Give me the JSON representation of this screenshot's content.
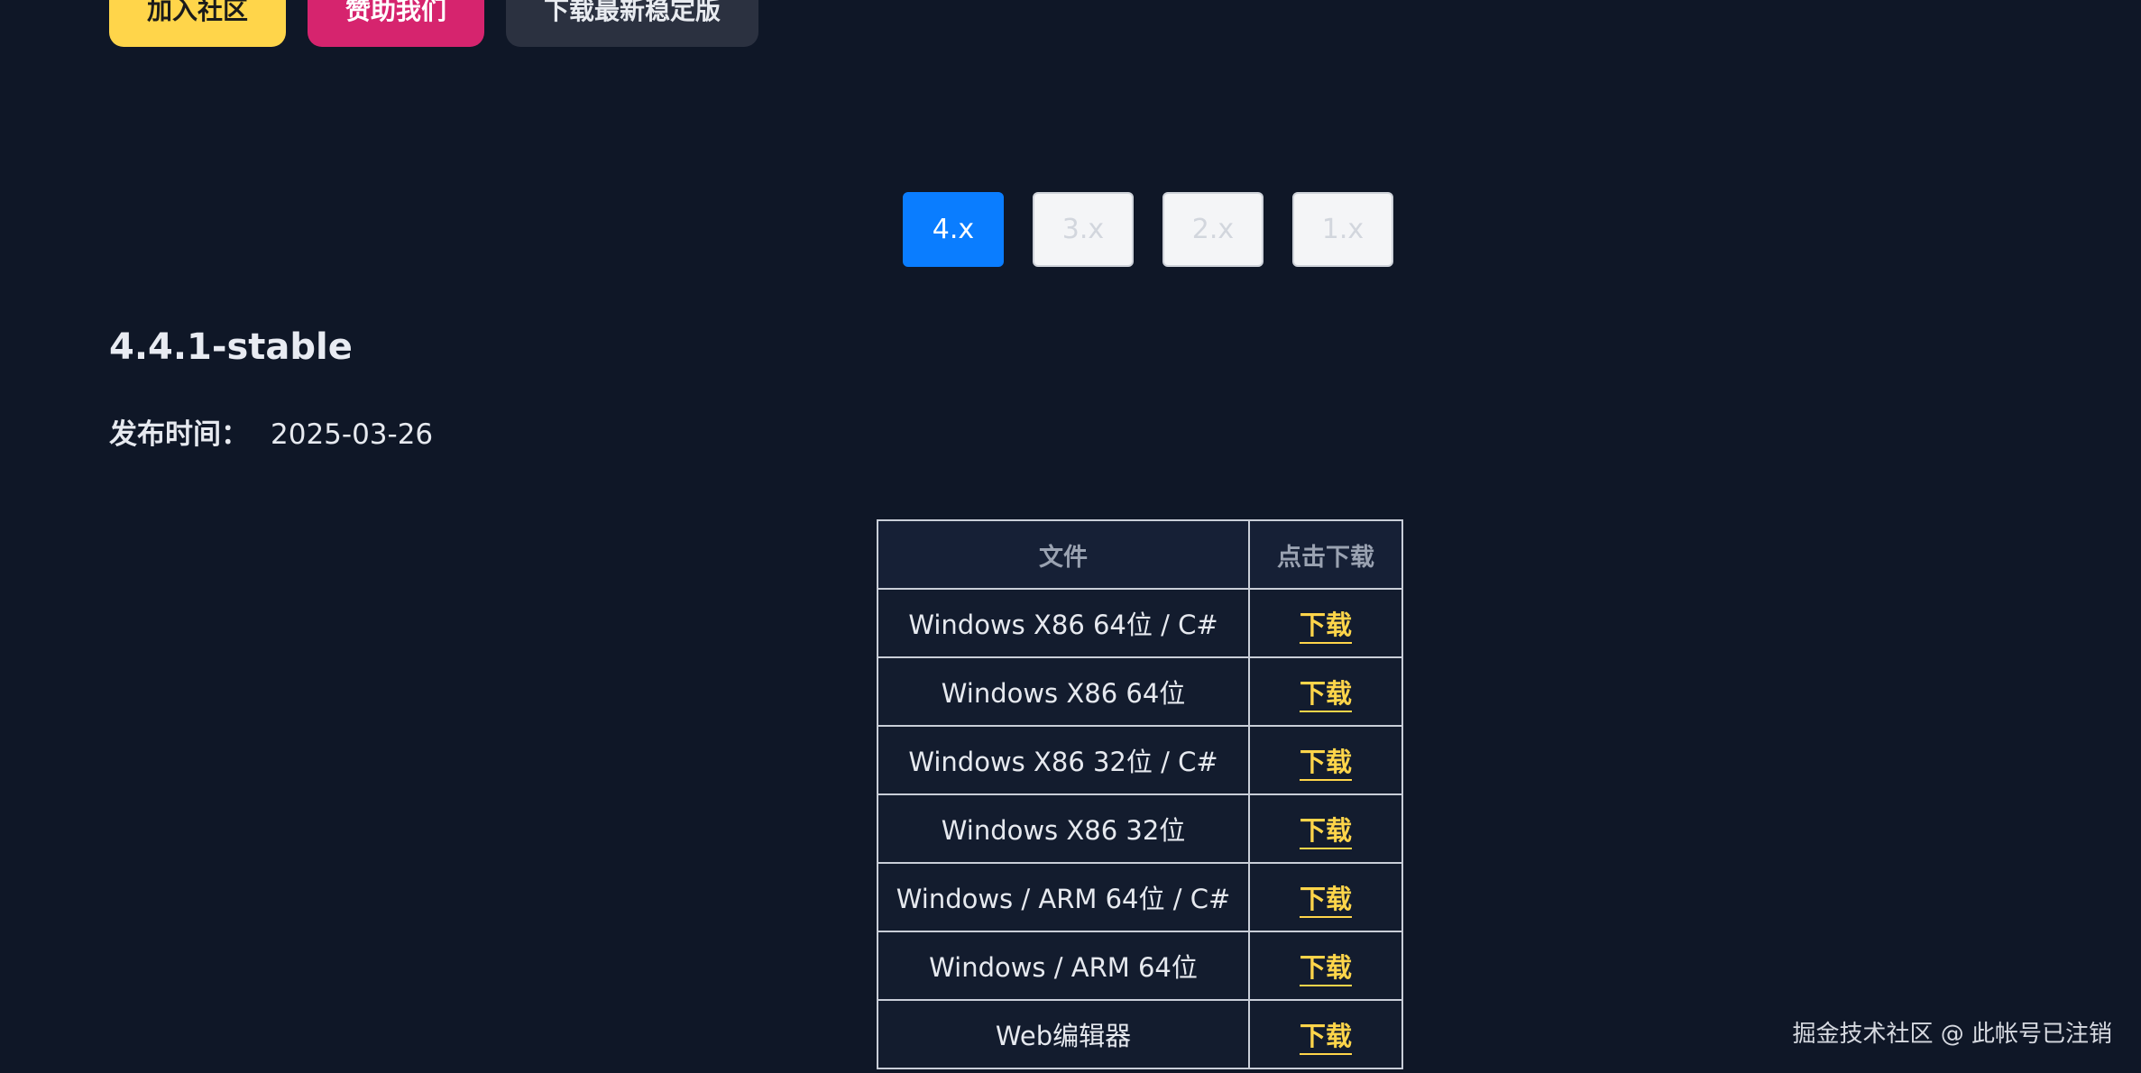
{
  "top_actions": {
    "join_community": "加入社区",
    "sponsor": "赞助我们",
    "download_latest": "下载最新稳定版"
  },
  "version_tabs": [
    {
      "label": "4.x",
      "active": true
    },
    {
      "label": "3.x",
      "active": false
    },
    {
      "label": "2.x",
      "active": false
    },
    {
      "label": "1.x",
      "active": false
    }
  ],
  "release": {
    "title": "4.4.1-stable",
    "date_label": "发布时间：",
    "date_value": "2025-03-26"
  },
  "downloads": {
    "headers": [
      "文件",
      "点击下载"
    ],
    "rows": [
      {
        "file": "Windows X86 64位 / C#",
        "link": "下载"
      },
      {
        "file": "Windows X86 64位",
        "link": "下载"
      },
      {
        "file": "Windows X86 32位 / C#",
        "link": "下载"
      },
      {
        "file": "Windows X86 32位",
        "link": "下载"
      },
      {
        "file": "Windows / ARM 64位 / C#",
        "link": "下载"
      },
      {
        "file": "Windows / ARM 64位",
        "link": "下载"
      },
      {
        "file": "Web编辑器",
        "link": "下载"
      }
    ]
  },
  "watermark": "掘金技术社区 @ 此帐号已注销",
  "colors": {
    "background": "#0f1727",
    "accent_blue": "#0a7dff",
    "accent_yellow": "#ffd54a",
    "accent_pink": "#d6246e"
  }
}
